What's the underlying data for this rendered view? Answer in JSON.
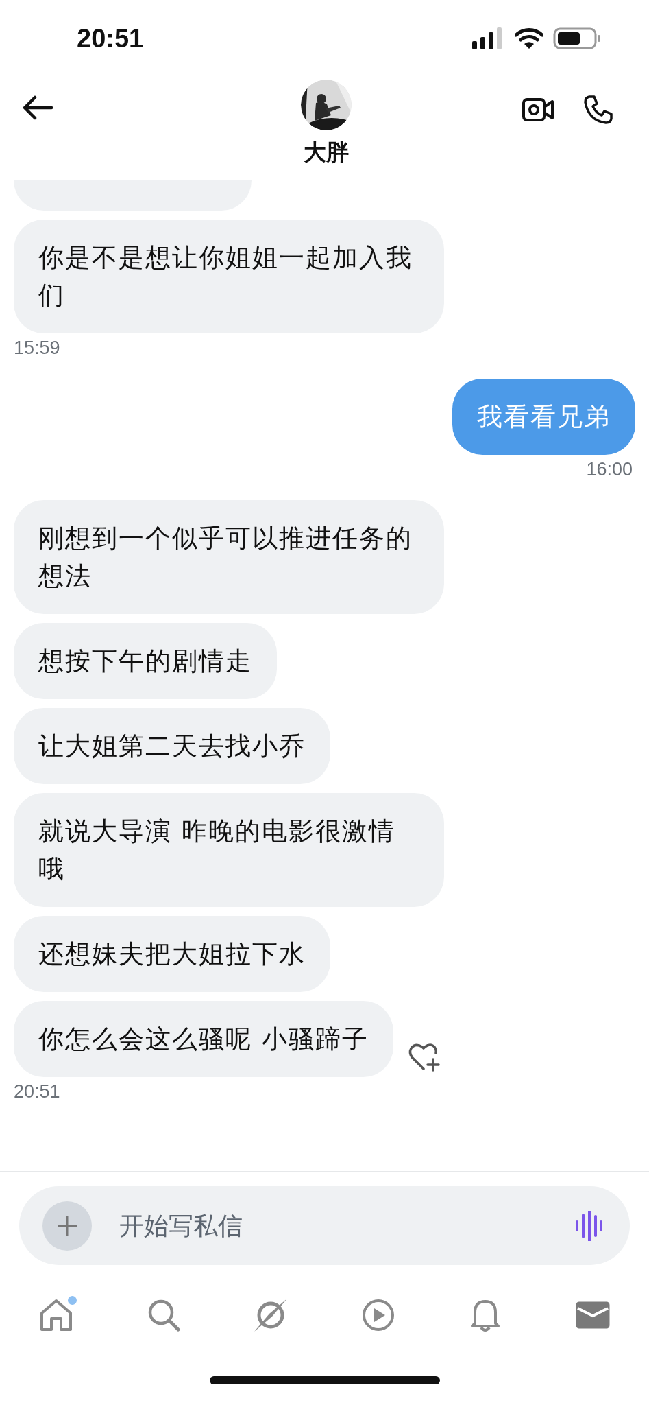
{
  "status_bar": {
    "time": "20:51"
  },
  "header": {
    "name": "大胖"
  },
  "messages": [
    {
      "kind": "partial"
    },
    {
      "kind": "received",
      "text": "你是不是想让你姐姐一起加入我们",
      "reaction_button": false
    },
    {
      "kind": "received_time",
      "text": "15:59"
    },
    {
      "kind": "sent",
      "text": "我看看兄弟",
      "reaction_button": false
    },
    {
      "kind": "sent_time",
      "text": "16:00"
    },
    {
      "kind": "received",
      "text": "刚想到一个似乎可以推进任务的想法",
      "reaction_button": false
    },
    {
      "kind": "received",
      "text": "想按下午的剧情走",
      "reaction_button": false
    },
    {
      "kind": "received",
      "text": "让大姐第二天去找小乔",
      "reaction_button": false
    },
    {
      "kind": "received",
      "text": "就说大导演  昨晚的电影很激情哦",
      "reaction_button": false
    },
    {
      "kind": "received",
      "text": "还想妹夫把大姐拉下水",
      "reaction_button": false
    },
    {
      "kind": "received",
      "text": "你怎么会这么骚呢  小骚蹄子",
      "reaction_button": true
    },
    {
      "kind": "received_time",
      "text": "20:51"
    }
  ],
  "composer": {
    "placeholder": "开始写私信"
  },
  "nav": [
    {
      "kind": "home",
      "selected": false,
      "badge": true
    },
    {
      "kind": "search",
      "selected": false,
      "badge": false
    },
    {
      "kind": "compass",
      "selected": false,
      "badge": false
    },
    {
      "kind": "play",
      "selected": false,
      "badge": false
    },
    {
      "kind": "bell",
      "selected": false,
      "badge": false
    },
    {
      "kind": "mail",
      "selected": true,
      "badge": false
    }
  ]
}
